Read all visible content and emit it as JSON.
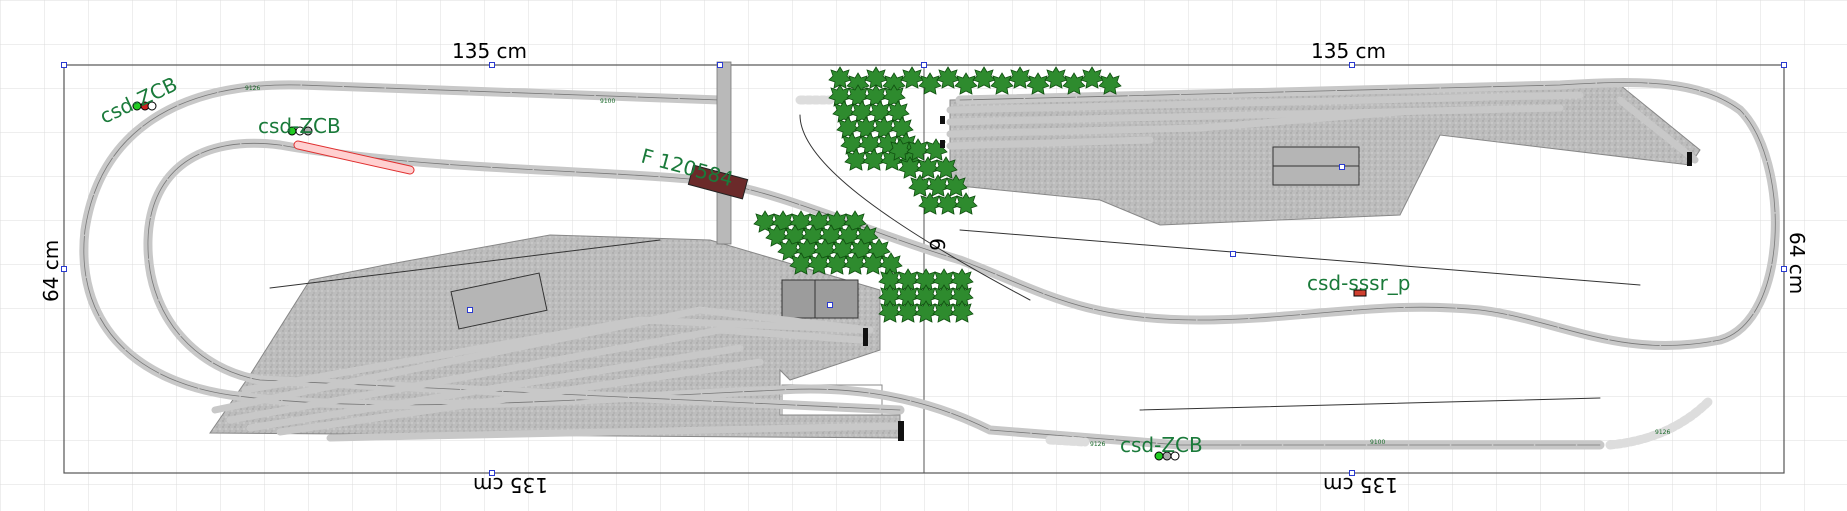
{
  "dimensions": {
    "top_left": "135 cm",
    "top_right": "135 cm",
    "bottom_left": "135 cm",
    "bottom_right": "135 cm",
    "left": "64 cm",
    "right": "64 cm"
  },
  "labels": {
    "signal_1": "csd-ZCB",
    "signal_2": "csd-ZCB",
    "signal_3": "csd-ZCB",
    "signal_4": "csd-sssr_p",
    "car": "F 120584",
    "fragment": "6"
  },
  "track_tags": [
    "9126",
    "9100",
    "9100",
    "9126",
    "9126"
  ],
  "colors": {
    "track": "#c8c8c8",
    "ballast": "#bdbdbd",
    "tree": "#1f7a1f",
    "label": "#1a7a3a",
    "selected_track": "#e03030"
  }
}
